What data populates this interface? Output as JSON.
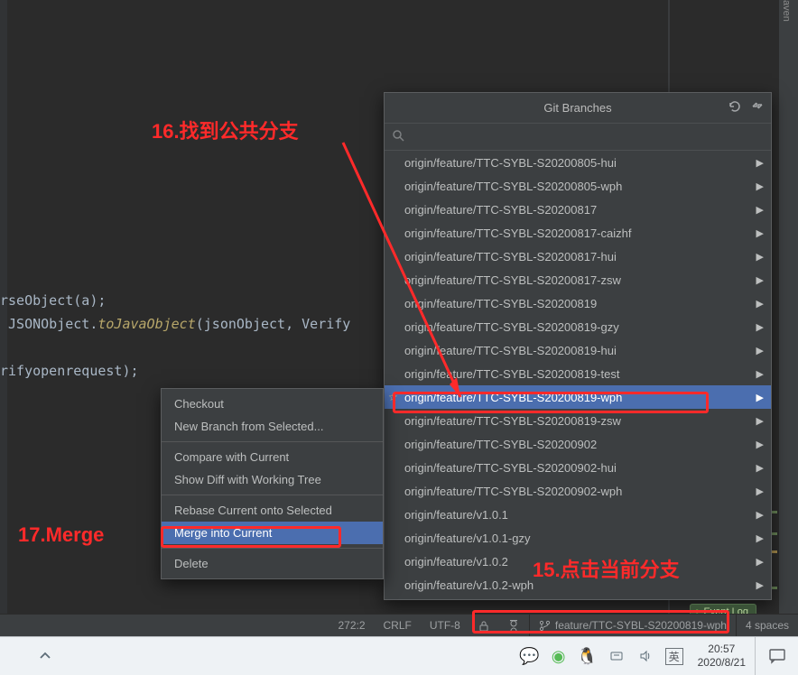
{
  "editor": {
    "line1a": "rseObject",
    "line1b": "(a);",
    "line2a": " JSONObject.",
    "line2fn": "toJavaObject",
    "line2b": "(jsonObject, Verify",
    "line3": "",
    "line4": "rifyopenrequest);"
  },
  "right_bar": {
    "label": "aven"
  },
  "branches_popup": {
    "title": "Git Branches",
    "search_placeholder": "",
    "items": [
      {
        "label": "origin/feature/TTC-SYBL-S20200805-hui",
        "selected": false,
        "star": false
      },
      {
        "label": "origin/feature/TTC-SYBL-S20200805-wph",
        "selected": false,
        "star": false
      },
      {
        "label": "origin/feature/TTC-SYBL-S20200817",
        "selected": false,
        "star": false
      },
      {
        "label": "origin/feature/TTC-SYBL-S20200817-caizhf",
        "selected": false,
        "star": false
      },
      {
        "label": "origin/feature/TTC-SYBL-S20200817-hui",
        "selected": false,
        "star": false
      },
      {
        "label": "origin/feature/TTC-SYBL-S20200817-zsw",
        "selected": false,
        "star": false
      },
      {
        "label": "origin/feature/TTC-SYBL-S20200819",
        "selected": false,
        "star": false
      },
      {
        "label": "origin/feature/TTC-SYBL-S20200819-gzy",
        "selected": false,
        "star": false
      },
      {
        "label": "origin/feature/TTC-SYBL-S20200819-hui",
        "selected": false,
        "star": false
      },
      {
        "label": "origin/feature/TTC-SYBL-S20200819-test",
        "selected": false,
        "star": false
      },
      {
        "label": "origin/feature/TTC-SYBL-S20200819-wph",
        "selected": true,
        "star": true
      },
      {
        "label": "origin/feature/TTC-SYBL-S20200819-zsw",
        "selected": false,
        "star": false
      },
      {
        "label": "origin/feature/TTC-SYBL-S20200902",
        "selected": false,
        "star": false
      },
      {
        "label": "origin/feature/TTC-SYBL-S20200902-hui",
        "selected": false,
        "star": false
      },
      {
        "label": "origin/feature/TTC-SYBL-S20200902-wph",
        "selected": false,
        "star": false
      },
      {
        "label": "origin/feature/v1.0.1",
        "selected": false,
        "star": false
      },
      {
        "label": "origin/feature/v1.0.1-gzy",
        "selected": false,
        "star": false
      },
      {
        "label": "origin/feature/v1.0.2",
        "selected": false,
        "star": false
      },
      {
        "label": "origin/feature/v1.0.2-wph",
        "selected": false,
        "star": false
      }
    ]
  },
  "context_menu": {
    "items": [
      {
        "label": "Checkout",
        "type": "item"
      },
      {
        "label": "New Branch from Selected...",
        "type": "item"
      },
      {
        "label": "",
        "type": "sep"
      },
      {
        "label": "Compare with Current",
        "type": "item"
      },
      {
        "label": "Show Diff with Working Tree",
        "type": "item"
      },
      {
        "label": "",
        "type": "sep"
      },
      {
        "label": "Rebase Current onto Selected",
        "type": "item"
      },
      {
        "label": "Merge into Current",
        "type": "item",
        "selected": true
      },
      {
        "label": "",
        "type": "sep"
      },
      {
        "label": "Delete",
        "type": "item"
      }
    ]
  },
  "ide_status": {
    "caret": "272:2",
    "line_sep": "CRLF",
    "encoding": "UTF-8",
    "branch": "feature/TTC-SYBL-S20200819-wph",
    "indent": "4 spaces"
  },
  "event_log": {
    "label": "Event Log"
  },
  "taskbar": {
    "ime": "英",
    "time": "20:57",
    "date": "2020/8/21"
  },
  "annotations": {
    "a16": "16.找到公共分支",
    "a17": "17.Merge",
    "a15": "15.点击当前分支"
  }
}
